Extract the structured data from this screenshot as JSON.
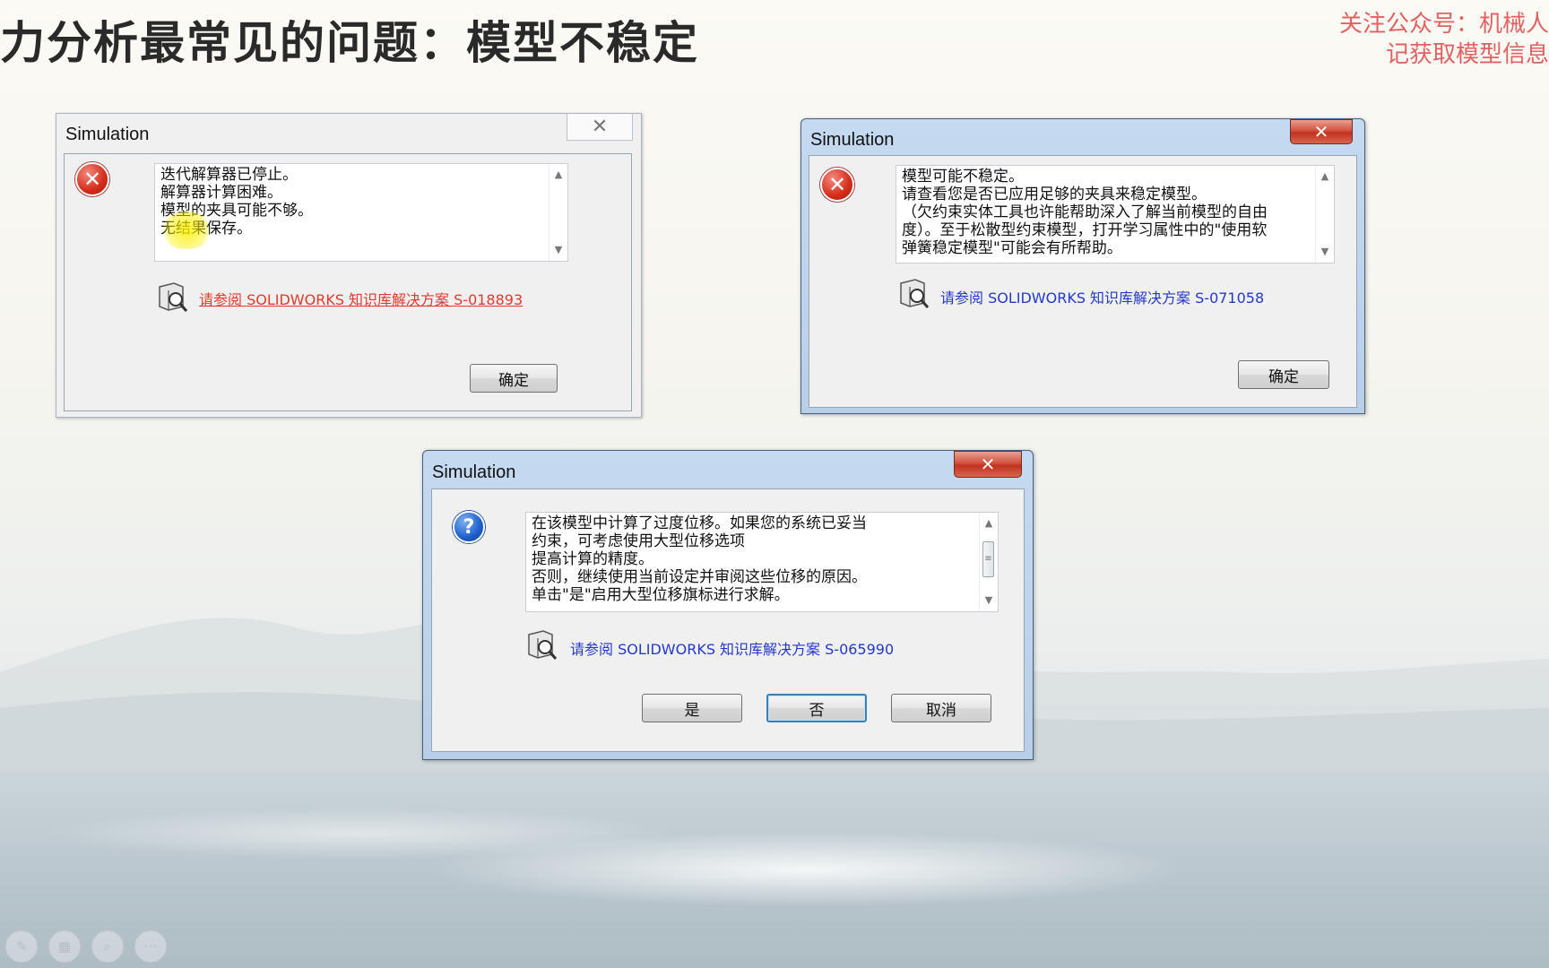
{
  "slide": {
    "title": "力分析最常见的问题：模型不稳定",
    "watermark_line1": "关注公众号：机械人",
    "watermark_line2": "记获取模型信息"
  },
  "dialog1": {
    "title": "Simulation",
    "close": "✕",
    "lines": [
      "迭代解算器已停止。",
      "解算器计算困难。",
      "模型的夹具可能不够。",
      "无结果保存。"
    ],
    "kb_link": "请参阅 SOLIDWORKS 知识库解决方案 S-018893",
    "ok": "确定"
  },
  "dialog2": {
    "title": "Simulation",
    "close": "✕",
    "lines": [
      "模型可能不稳定。",
      "请查看您是否已应用足够的夹具来稳定模型。",
      "（欠约束实体工具也许能帮助深入了解当前模型的自由",
      "度）。至于松散型约束模型，打开学习属性中的\"使用软",
      "弹簧稳定模型\"可能会有所帮助。"
    ],
    "kb_link": "请参阅 SOLIDWORKS 知识库解决方案 S-071058",
    "ok": "确定"
  },
  "dialog3": {
    "title": "Simulation",
    "close": "✕",
    "lines": [
      "在该模型中计算了过度位移。如果您的系统已妥当",
      "约束，可考虑使用大型位移选项",
      "提高计算的精度。",
      "否则，继续使用当前设定并审阅这些位移的原因。",
      "单击\"是\"启用大型位移旗标进行求解。"
    ],
    "kb_link": "请参阅 SOLIDWORKS 知识库解决方案 S-065990",
    "yes": "是",
    "no": "否",
    "cancel": "取消"
  },
  "toolbar": {
    "pen": "✎",
    "slides": "▦",
    "zoom": "⌕",
    "more": "···"
  },
  "icons": {
    "error": "✕",
    "question": "?",
    "scroll_up": "▲",
    "scroll_down": "▼",
    "grip": "≡"
  }
}
